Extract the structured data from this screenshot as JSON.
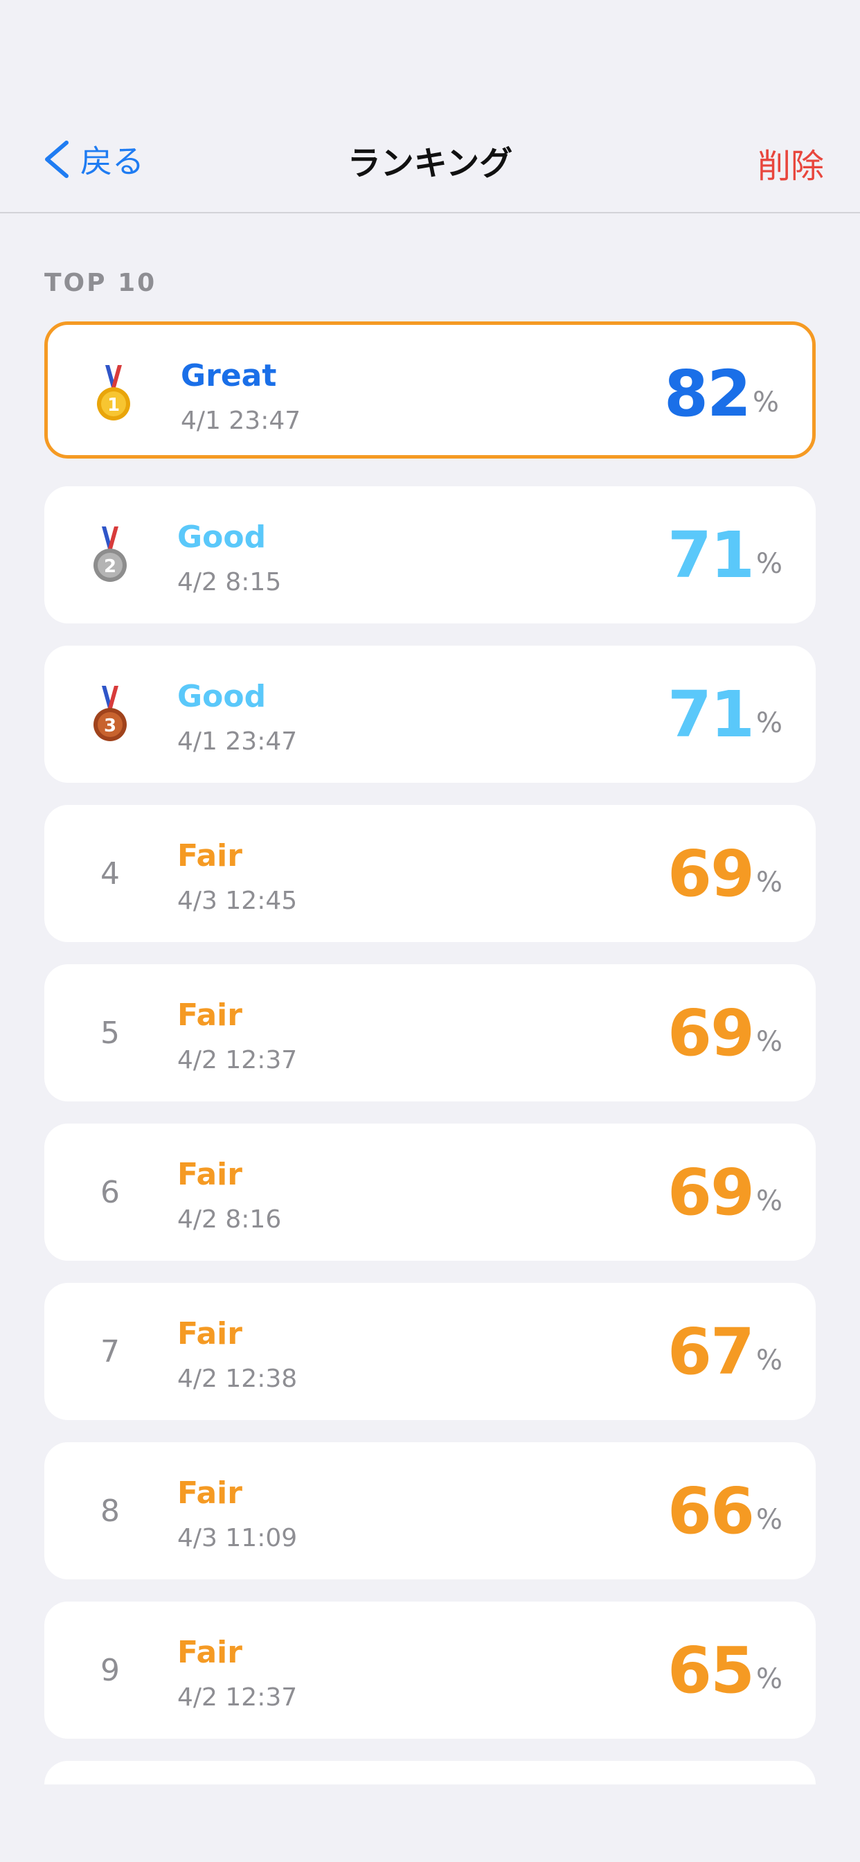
{
  "nav": {
    "back_label": "戻る",
    "title": "ランキング",
    "delete_label": "削除"
  },
  "section": {
    "header": "TOP 10"
  },
  "colors": {
    "accent": "#1f7cf2",
    "great": "#1a6fe8",
    "good": "#5ac8fa",
    "fair": "#f59a23",
    "delete": "#e8463d"
  },
  "rows": [
    {
      "rank": "1",
      "medal": "gold-medal-icon",
      "grade": "Great",
      "date": "4/1 23:47",
      "score": "82",
      "unit": "%"
    },
    {
      "rank": "2",
      "medal": "silver-medal-icon",
      "grade": "Good",
      "date": "4/2 8:15",
      "score": "71",
      "unit": "%"
    },
    {
      "rank": "3",
      "medal": "bronze-medal-icon",
      "grade": "Good",
      "date": "4/1 23:47",
      "score": "71",
      "unit": "%"
    },
    {
      "rank": "4",
      "grade": "Fair",
      "date": "4/3 12:45",
      "score": "69",
      "unit": "%"
    },
    {
      "rank": "5",
      "grade": "Fair",
      "date": "4/2 12:37",
      "score": "69",
      "unit": "%"
    },
    {
      "rank": "6",
      "grade": "Fair",
      "date": "4/2 8:16",
      "score": "69",
      "unit": "%"
    },
    {
      "rank": "7",
      "grade": "Fair",
      "date": "4/2 12:38",
      "score": "67",
      "unit": "%"
    },
    {
      "rank": "8",
      "grade": "Fair",
      "date": "4/3 11:09",
      "score": "66",
      "unit": "%"
    },
    {
      "rank": "9",
      "grade": "Fair",
      "date": "4/2 12:37",
      "score": "65",
      "unit": "%"
    }
  ]
}
